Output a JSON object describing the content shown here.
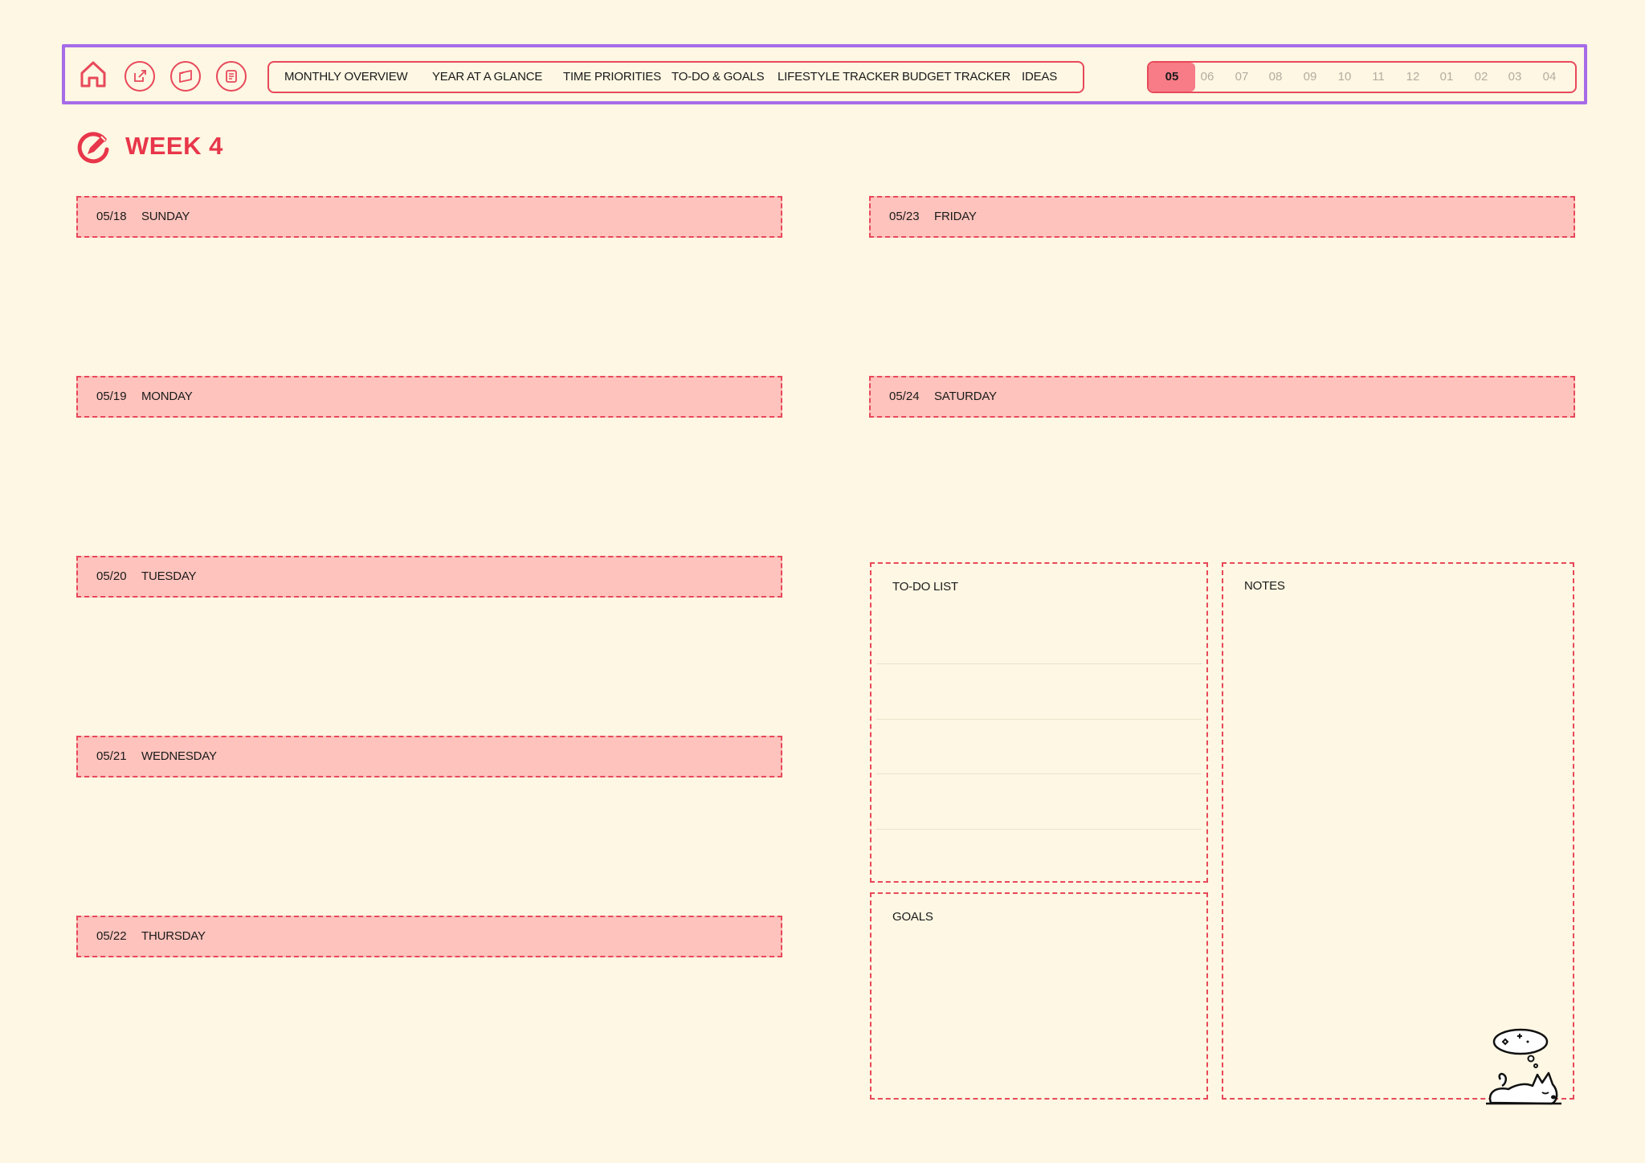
{
  "nav": {
    "icons": [
      "home-icon",
      "edit-icon",
      "folder-icon",
      "notes-icon"
    ],
    "items": [
      "MONTHLY OVERVIEW",
      "YEAR AT A GLANCE",
      "TIME PRIORITIES",
      "TO-DO & GOALS",
      "LIFESTYLE TRACKER",
      "BUDGET TRACKER",
      "IDEAS"
    ],
    "months": [
      "05",
      "06",
      "07",
      "08",
      "09",
      "10",
      "11",
      "12",
      "01",
      "02",
      "03",
      "04"
    ],
    "active_month": "05"
  },
  "page": {
    "title": "WEEK 4"
  },
  "days": [
    {
      "date": "05/18",
      "name": "SUNDAY"
    },
    {
      "date": "05/19",
      "name": "MONDAY"
    },
    {
      "date": "05/20",
      "name": "TUESDAY"
    },
    {
      "date": "05/21",
      "name": "WEDNESDAY"
    },
    {
      "date": "05/22",
      "name": "THURSDAY"
    },
    {
      "date": "05/23",
      "name": "FRIDAY"
    },
    {
      "date": "05/24",
      "name": "SATURDAY"
    }
  ],
  "todo": {
    "label": "TO-DO LIST"
  },
  "goals": {
    "label": "GOALS"
  },
  "notes": {
    "label": "NOTES"
  },
  "colors": {
    "accent": "#e8485a",
    "title": "#e8364a",
    "day_fill": "#fdc3bc",
    "background": "#fdf7e3",
    "frame": "#a66be8",
    "active_month": "#f77c87"
  }
}
